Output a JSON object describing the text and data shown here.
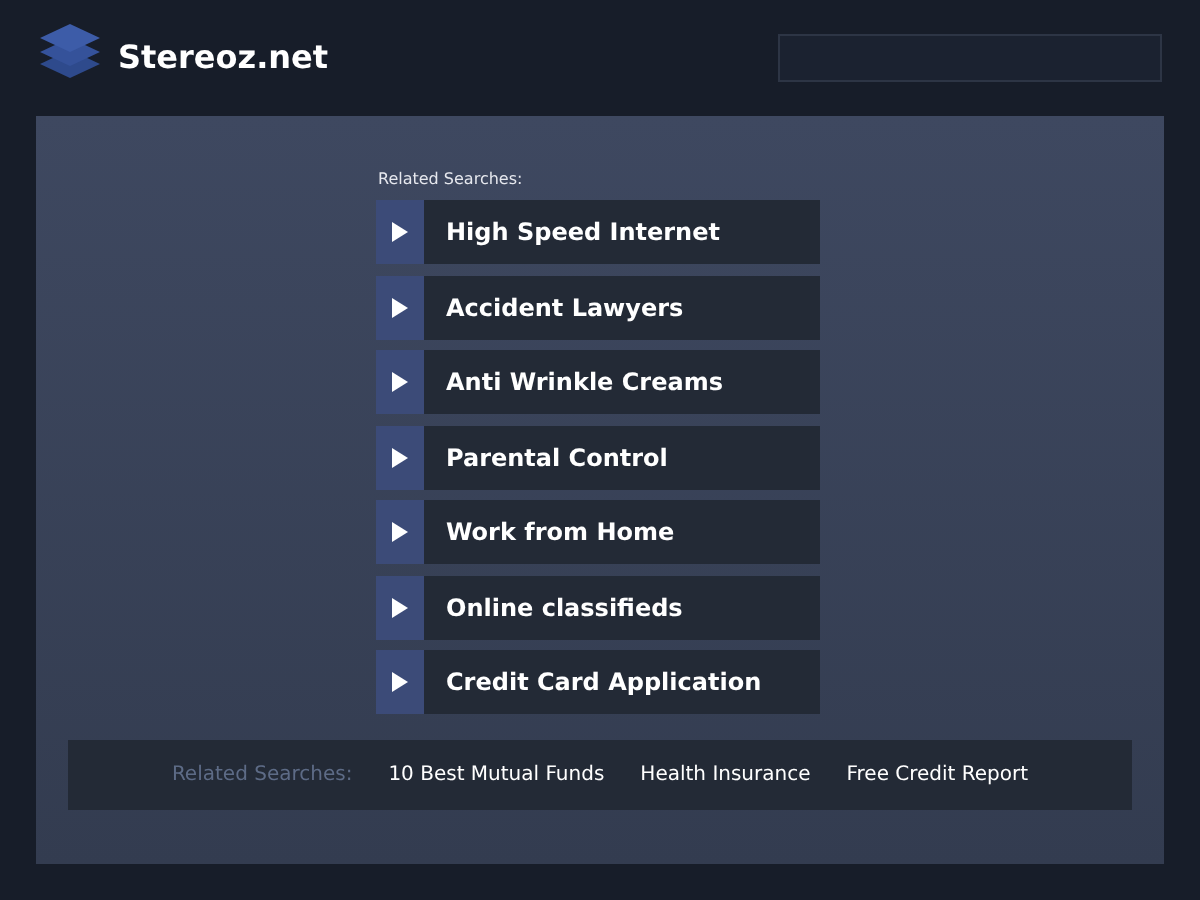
{
  "site": {
    "title": "Stereoz.net"
  },
  "related": {
    "heading": "Related Searches:",
    "links": [
      "High Speed Internet",
      "Accident Lawyers",
      "Anti Wrinkle Creams",
      "Parental Control",
      "Work from Home",
      "Online classifieds",
      "Credit Card Application"
    ]
  },
  "footer": {
    "heading": "Related Searches:",
    "links": [
      "10 Best Mutual Funds",
      "Health Insurance",
      "Free Credit Report"
    ]
  }
}
